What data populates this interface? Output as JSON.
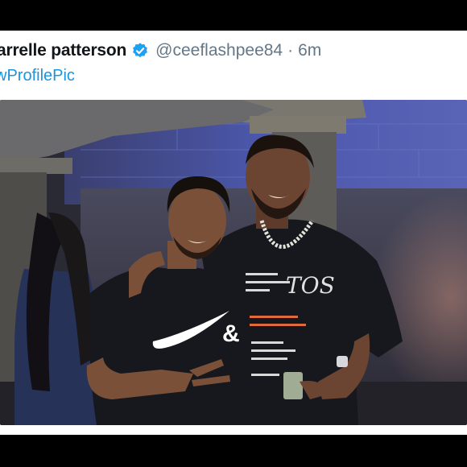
{
  "tweet": {
    "display_name": "arrelle patterson",
    "handle": "@ceeflashpee84",
    "separator": "·",
    "time": "6m",
    "hashtag": "wProfilePic",
    "verified_icon": "verified-badge-icon"
  },
  "photo": {
    "shirt_left_text": "&",
    "shirt_right_heading": "TOS",
    "colors": {
      "wall_blue": "#4a56a8",
      "shirt": "#17181d",
      "skin": "#6b4532",
      "verified_blue": "#1da1f2",
      "link_blue": "#1b95e0"
    }
  }
}
